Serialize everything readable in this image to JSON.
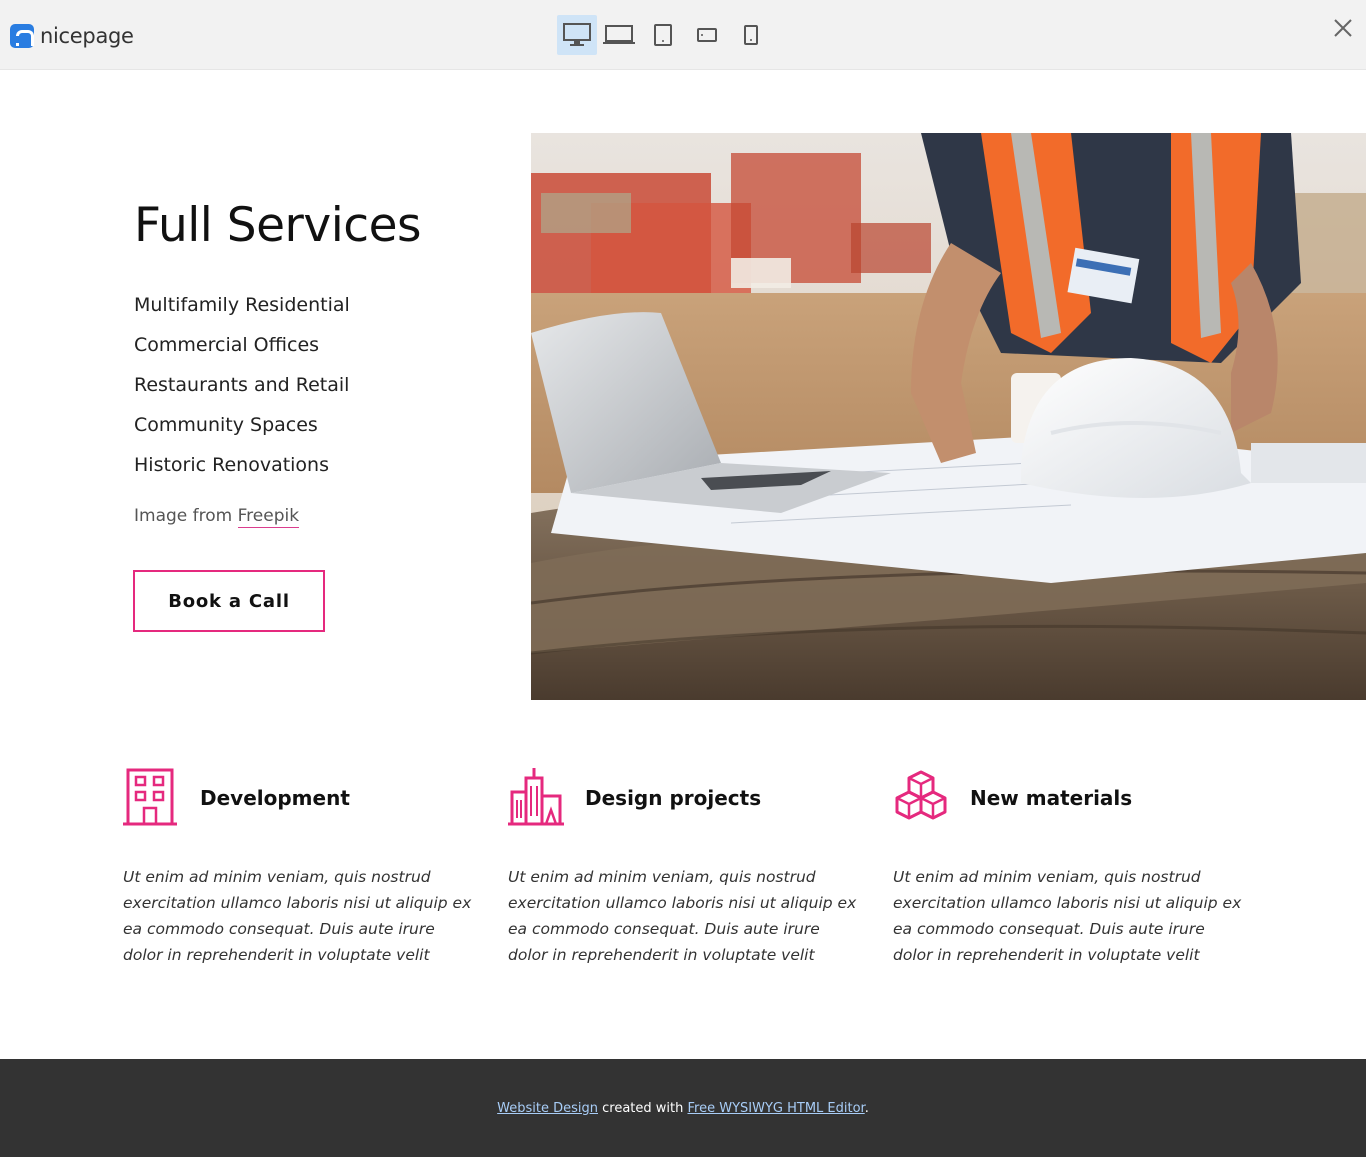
{
  "topbar": {
    "logo_text": "nicepage",
    "devices": [
      {
        "name": "desktop",
        "active": true
      },
      {
        "name": "laptop",
        "active": false
      },
      {
        "name": "tablet",
        "active": false
      },
      {
        "name": "phone-landscape",
        "active": false
      },
      {
        "name": "phone-portrait",
        "active": false
      }
    ],
    "close_icon": "close-icon"
  },
  "hero": {
    "title": "Full Services",
    "services": [
      "Multifamily Residential",
      "Commercial Offices",
      "Restaurants and Retail",
      "Community Spaces",
      "Historic Renovations"
    ],
    "credit_prefix": "Image from ",
    "credit_link": "Freepik",
    "cta_label": "Book a Call"
  },
  "features": [
    {
      "icon": "building-icon",
      "title": "Development",
      "text": "Ut enim ad minim veniam, quis nostrud exercitation ullamco laboris nisi ut aliquip ex ea commodo consequat. Duis aute irure dolor in reprehenderit in voluptate velit"
    },
    {
      "icon": "city-buildings-icon",
      "title": "Design projects",
      "text": "Ut enim ad minim veniam, quis nostrud exercitation ullamco laboris nisi ut aliquip ex ea commodo consequat. Duis aute irure dolor in reprehenderit in voluptate velit"
    },
    {
      "icon": "cubes-icon",
      "title": "New materials",
      "text": "Ut enim ad minim veniam, quis nostrud exercitation ullamco laboris nisi ut aliquip ex ea commodo consequat. Duis aute irure dolor in reprehenderit in voluptate velit"
    }
  ],
  "footer": {
    "link1": "Website Design",
    "middle": " created with ",
    "link2": "Free WYSIWYG HTML Editor",
    "end": "."
  },
  "colors": {
    "accent": "#e5297e",
    "logo_blue": "#2a7de1",
    "footer_bg": "#333333",
    "footer_link": "#a8cdf7",
    "active_device_bg": "#cfe4f7"
  }
}
